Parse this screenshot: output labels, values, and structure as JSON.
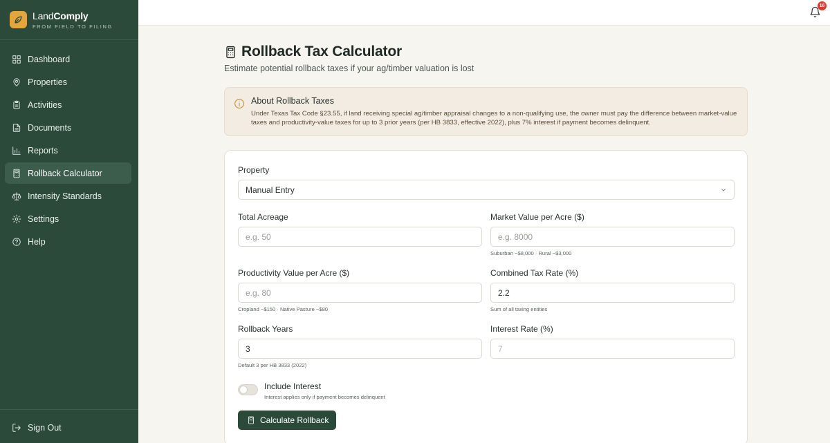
{
  "brand": {
    "name_part1": "Land",
    "name_part2": "Comply",
    "tagline": "FROM FIELD TO FILING",
    "logo_icon": "leaf-icon",
    "logo_color": "#e3a53c"
  },
  "sidebar": {
    "items": [
      {
        "label": "Dashboard",
        "icon": "grid-icon",
        "active": false
      },
      {
        "label": "Properties",
        "icon": "map-pin-icon",
        "active": false
      },
      {
        "label": "Activities",
        "icon": "clipboard-icon",
        "active": false
      },
      {
        "label": "Documents",
        "icon": "document-icon",
        "active": false
      },
      {
        "label": "Reports",
        "icon": "bar-chart-icon",
        "active": false
      },
      {
        "label": "Rollback Calculator",
        "icon": "calculator-icon",
        "active": true
      },
      {
        "label": "Intensity Standards",
        "icon": "scale-icon",
        "active": false
      },
      {
        "label": "Settings",
        "icon": "gear-icon",
        "active": false
      },
      {
        "label": "Help",
        "icon": "help-icon",
        "active": false
      }
    ],
    "sign_out": "Sign Out"
  },
  "topbar": {
    "notification_count": "16"
  },
  "page": {
    "title": "Rollback Tax Calculator",
    "subtitle": "Estimate potential rollback taxes if your ag/timber valuation is lost"
  },
  "info": {
    "title": "About Rollback Taxes",
    "body": "Under Texas Tax Code §23.55, if land receiving special ag/timber appraisal changes to a non-qualifying use, the owner must pay the difference between market-value taxes and productivity-value taxes for up to 3 prior years (per HB 3833, effective 2022), plus 7% interest if payment becomes delinquent."
  },
  "form": {
    "property": {
      "label": "Property",
      "value": "Manual Entry"
    },
    "total_acreage": {
      "label": "Total Acreage",
      "placeholder": "e.g. 50",
      "value": ""
    },
    "market_value": {
      "label": "Market Value per Acre ($)",
      "placeholder": "e.g. 8000",
      "hint": "Suburban ~$8,000 · Rural ~$3,000"
    },
    "productivity_value": {
      "label": "Productivity Value per Acre ($)",
      "placeholder": "e.g. 80",
      "hint": "Cropland ~$150 · Native Pasture ~$80"
    },
    "tax_rate": {
      "label": "Combined Tax Rate (%)",
      "value": "2.2",
      "hint": "Sum of all taxing entities"
    },
    "rollback_years": {
      "label": "Rollback Years",
      "value": "3",
      "hint": "Default 3 per HB 3833 (2022)"
    },
    "interest_rate": {
      "label": "Interest Rate (%)",
      "placeholder": "7"
    },
    "include_interest": {
      "label": "Include Interest",
      "hint": "Interest applies only if payment becomes delinquent",
      "checked": false
    },
    "submit_label": "Calculate Rollback"
  },
  "colors": {
    "sidebar_bg": "#2b4a3a",
    "accent": "#2b4a3a",
    "badge": "#d93a2b",
    "info_bg": "#f3ece2"
  }
}
